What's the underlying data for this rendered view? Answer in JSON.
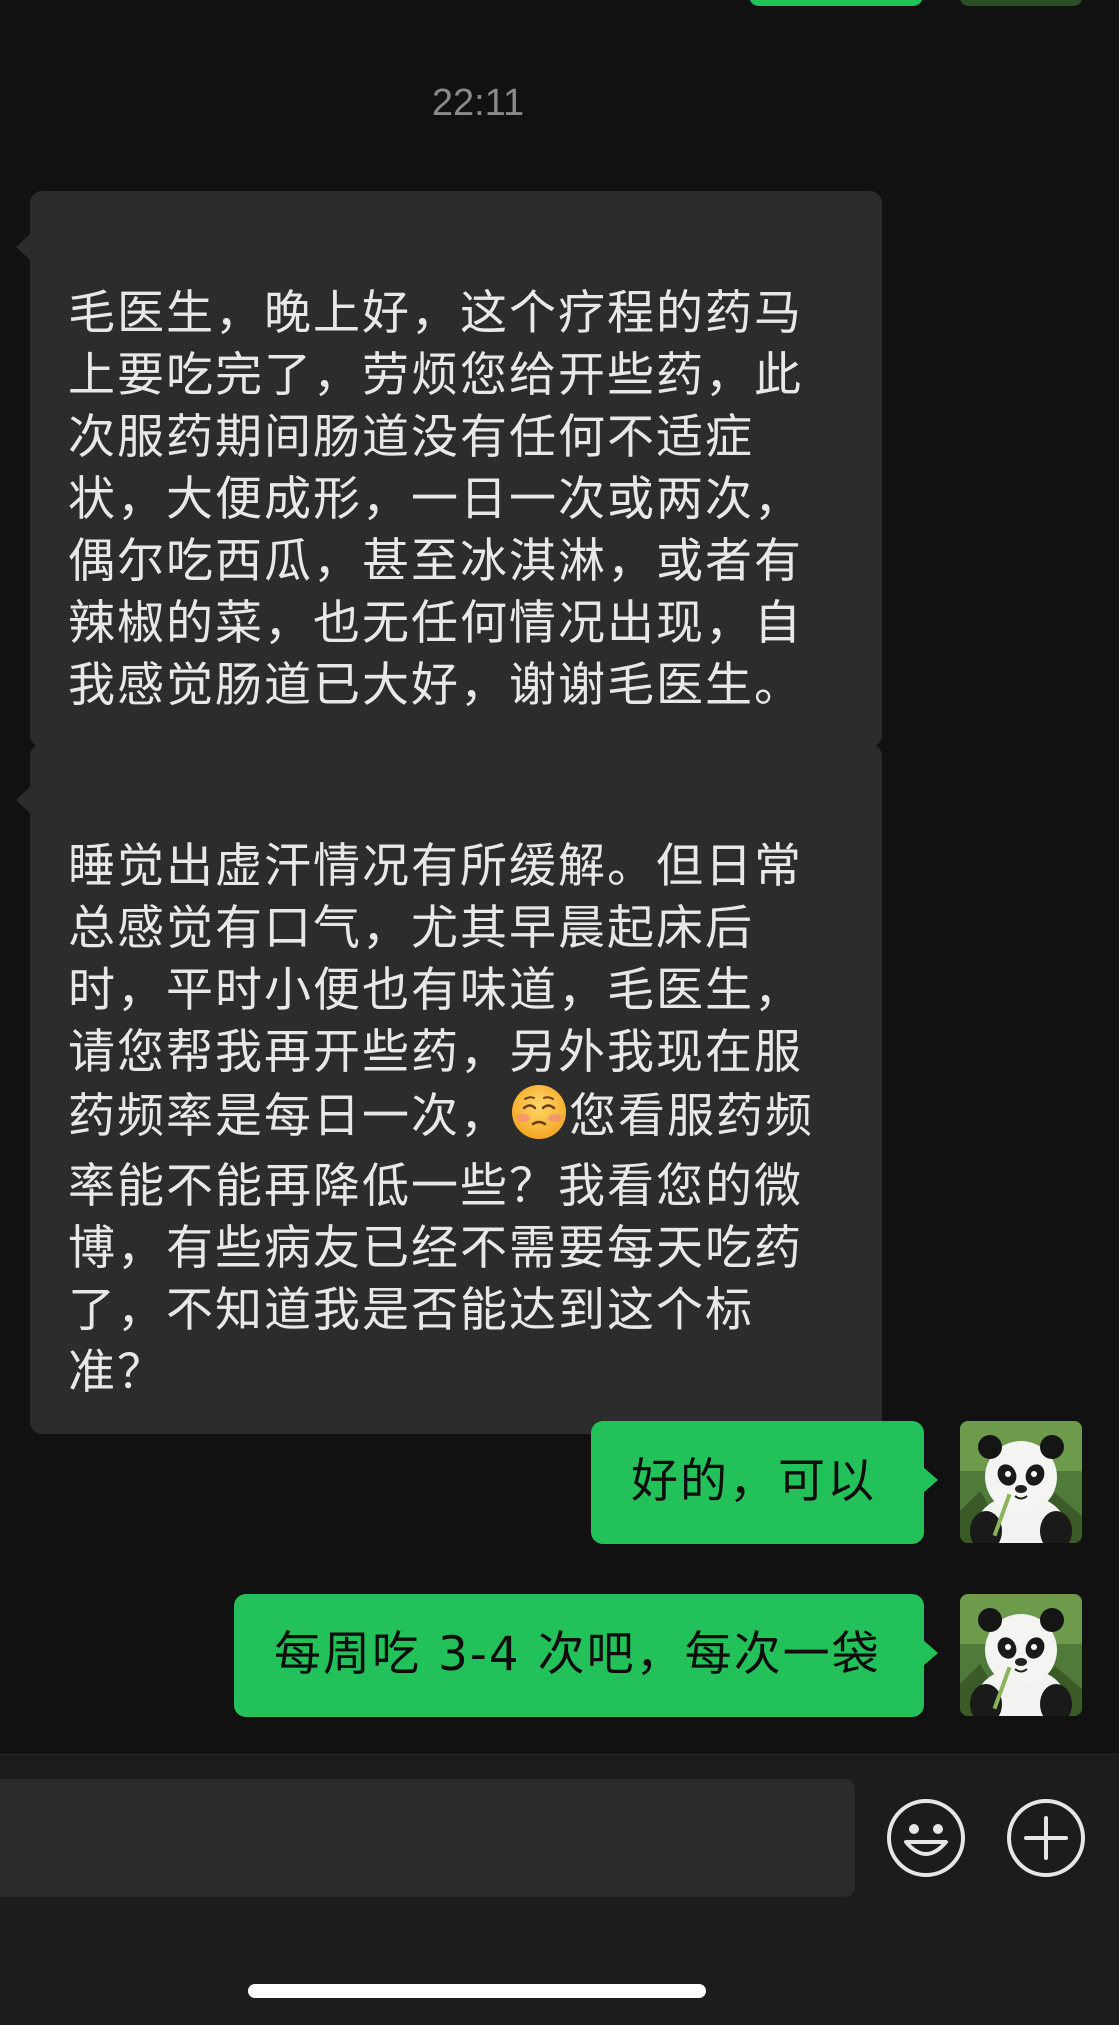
{
  "chat": {
    "timestamp": "22:11",
    "messages": [
      {
        "sender": "other",
        "text": "毛医生，晚上好，这个疗程的药马\n上要吃完了，劳烦您给开些药，此\n次服药期间肠道没有任何不适症\n状，大便成形，一日一次或两次，\n偶尔吃西瓜，甚至冰淇淋，或者有\n辣椒的菜，也无任何情况出现，自\n我感觉肠道已大好，谢谢毛医生。"
      },
      {
        "sender": "other",
        "text_before_emoji": "睡觉出虚汗情况有所缓解。但日常\n总感觉有口气，尤其早晨起床后\n时，平时小便也有味道，毛医生，\n请您帮我再开些药，另外我现在服\n药频率是每日一次，",
        "emoji": "pleading-face-emoji",
        "text_after_emoji": "您看服药频\n率能不能再降低一些？我看您的微\n博，有些病友已经不需要每天吃药\n了，不知道我是否能达到这个标\n准？"
      },
      {
        "sender": "self",
        "text": "好的，可以",
        "avatar": "panda-avatar"
      },
      {
        "sender": "self",
        "text": "每周吃 3-4 次吧，每次一袋",
        "avatar": "panda-avatar"
      }
    ]
  },
  "input_bar": {
    "emoji_button_icon": "smiley-icon",
    "more_button_icon": "plus-circle-icon"
  },
  "colors": {
    "background": "#111111",
    "incoming_bubble": "#2c2c2c",
    "outgoing_bubble": "#23c15a",
    "timestamp_text": "#8a8a8a"
  }
}
